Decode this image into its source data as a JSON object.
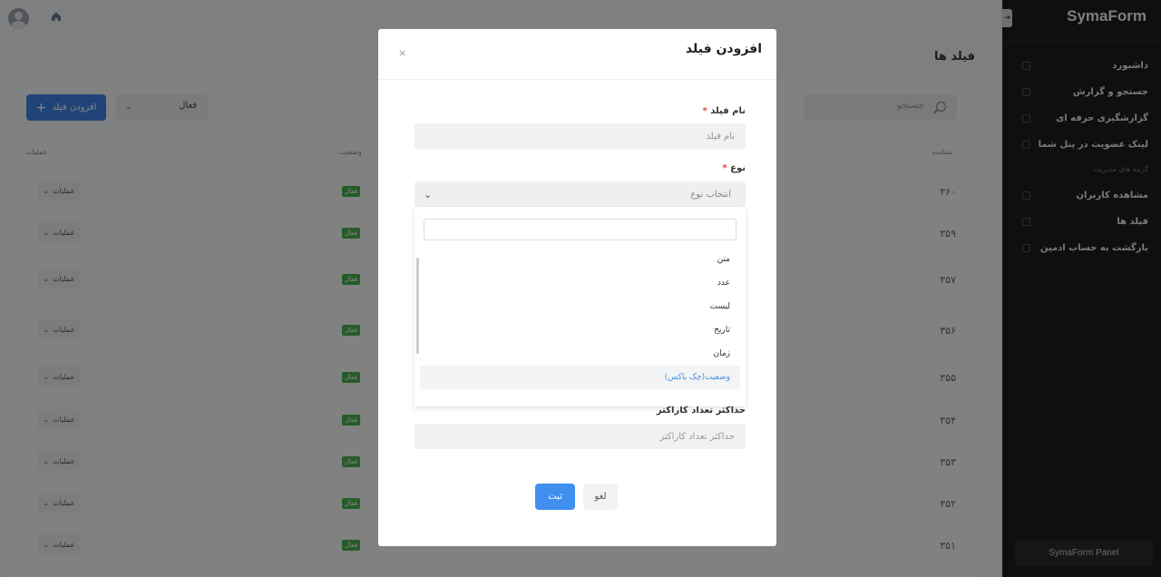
{
  "sidebar": {
    "brand": "SymaForm",
    "items": [
      {
        "label": "داشبورد",
        "icon": "grid-icon"
      },
      {
        "label": "جستجو و گزارش",
        "icon": "folder-icon"
      },
      {
        "label": "گزارشگیری حرفه ای",
        "icon": "folder-icon"
      },
      {
        "label": "لینک عضویت در پنل شما",
        "icon": "folder-icon"
      }
    ],
    "section_title": "گزینه های مدیریت",
    "admin_items": [
      {
        "label": "مشاهده کاربران",
        "icon": "doc-icon"
      },
      {
        "label": "فیلد ها",
        "icon": "folder-icon"
      },
      {
        "label": "بازگشت به حساب ادمین",
        "icon": "doc-icon"
      }
    ],
    "footer": "SymaForm Panel"
  },
  "page": {
    "title": "فیلد ها",
    "search_placeholder": "جستجو",
    "add_button": "افزودن فیلد",
    "status_filter": "فعال",
    "columns": {
      "id": "شناسه",
      "status": "وضعیت",
      "actions": "عملیات"
    },
    "rows": [
      {
        "id": "۳۶۰",
        "status": "فعال",
        "ops": "عملیات"
      },
      {
        "id": "۳۵۹",
        "status": "فعال",
        "ops": "عملیات"
      },
      {
        "id": "۳۵۷",
        "status": "فعال",
        "ops": "عملیات"
      },
      {
        "id": "۳۵۶",
        "status": "فعال",
        "ops": "عملیات"
      },
      {
        "id": "۳۵۵",
        "status": "فعال",
        "ops": "عملیات"
      },
      {
        "id": "۳۵۴",
        "status": "فعال",
        "ops": "عملیات"
      },
      {
        "id": "۳۵۳",
        "status": "فعال",
        "ops": "عملیات"
      },
      {
        "id": "۳۵۲",
        "status": "فعال",
        "ops": "عملیات"
      },
      {
        "id": "۳۵۱",
        "status": "فعال",
        "ops": "عملیات"
      }
    ]
  },
  "modal": {
    "title": "افزودن فیلد",
    "close": "×",
    "field_name_label": "نام فیلد",
    "field_name_placeholder": "نام فیلد",
    "type_label": "نوع",
    "type_placeholder": "انتخاب نوع",
    "type_options": [
      "متن",
      "عدد",
      "لیست",
      "تاریخ",
      "زمان",
      "وضعیت(چک باکس)"
    ],
    "max_chars_label": "حداکثر تعداد کاراکتر",
    "max_chars_placeholder": "حداکثر تعداد کاراکتر",
    "save": "ثبت",
    "cancel": "لغو",
    "required_mark": "*"
  },
  "colors": {
    "accent": "#3f83e6",
    "success": "#4caf50",
    "sidebar": "#1d1e20"
  }
}
